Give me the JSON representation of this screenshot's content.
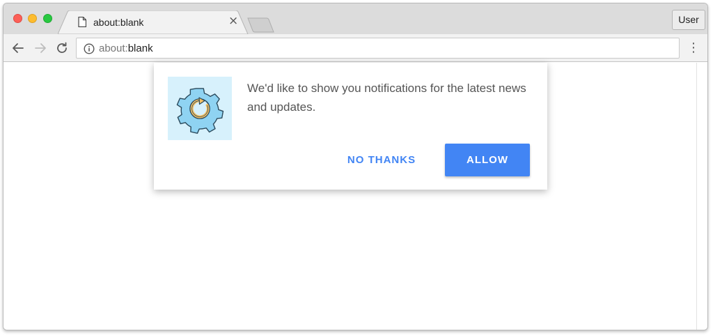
{
  "window": {
    "user_button_label": "User"
  },
  "tab": {
    "title": "about:blank",
    "close_glyph": "×",
    "icon": "document-icon"
  },
  "toolbar": {
    "back_icon": "back-arrow-icon",
    "forward_icon": "forward-arrow-icon",
    "reload_icon": "reload-icon",
    "menu_glyph": "⋮"
  },
  "address_bar": {
    "scheme": "about:",
    "path": "blank",
    "info_icon": "info-icon"
  },
  "notification_prompt": {
    "image_icon": "gear-refresh-icon",
    "message": "We'd like to show you notifications for the latest news and updates.",
    "decline_label": "NO THANKS",
    "accept_label": "ALLOW"
  },
  "colors": {
    "accent_blue": "#4285f4",
    "image_background": "#d7f1fc",
    "gear_fill": "#8fd3f2",
    "arrow_fill": "#f6c163"
  }
}
